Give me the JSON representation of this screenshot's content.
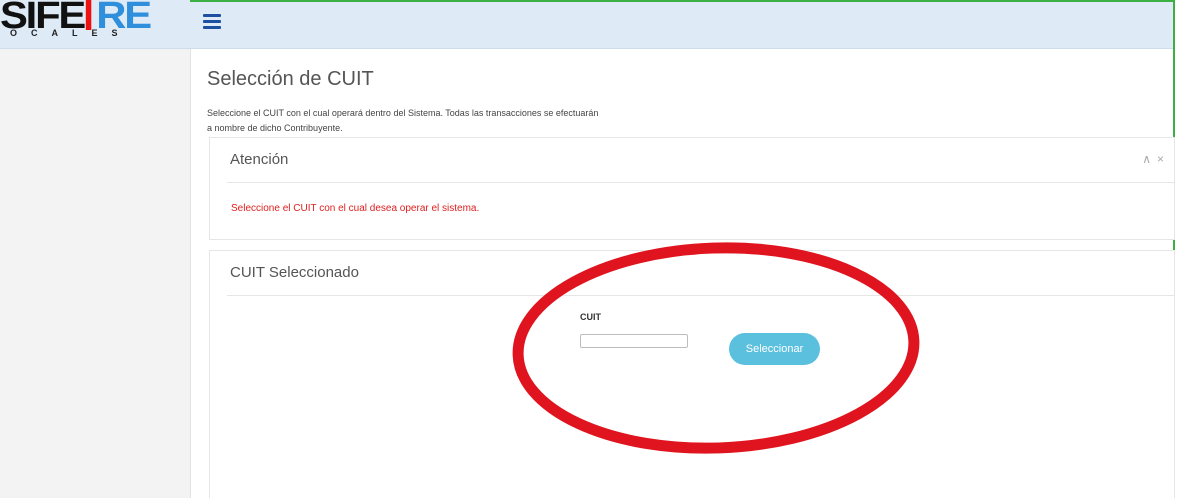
{
  "logo": {
    "main_dark": "SIFE",
    "main_blue": "RE",
    "sub": "OCALES"
  },
  "header": {
    "menu_icon": "hamburger-menu-icon"
  },
  "page": {
    "title": "Selección de CUIT",
    "description_line1": "Seleccione el CUIT con el cual operará dentro del Sistema. Todas las transacciones se efectuarán",
    "description_line2": "a nombre de dicho Contribuyente."
  },
  "attention_panel": {
    "title": "Atención",
    "collapse_icon": "chevron-up-icon",
    "close_icon": "close-icon",
    "message": "Seleccione el CUIT con el cual desea operar el sistema."
  },
  "cuit_panel": {
    "title": "CUIT Seleccionado",
    "field_label": "CUIT",
    "field_value": "",
    "button_label": "Seleccionar"
  },
  "colors": {
    "header_bg": "#deebf7",
    "button_bg": "#5bc0de",
    "warning_text": "#e02020",
    "annotation_red": "#e0141e",
    "frame_green": "#3cb043"
  }
}
